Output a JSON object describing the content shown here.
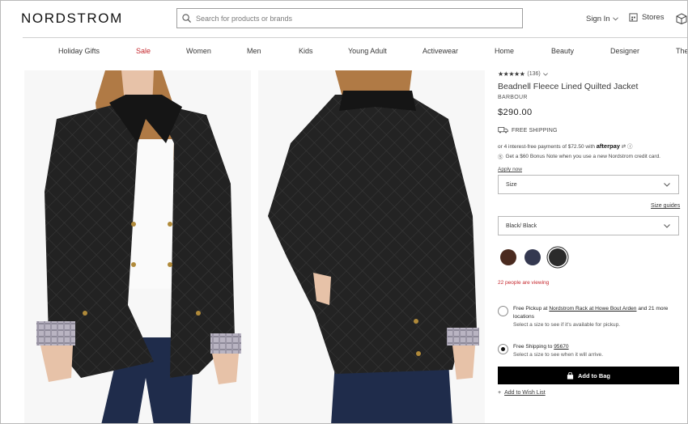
{
  "header": {
    "logo": "NORDSTROM",
    "search_placeholder": "Search for products or brands",
    "signin_label": "Sign In",
    "stores_label": "Stores"
  },
  "nav": {
    "items": [
      "Holiday Gifts",
      "Sale",
      "Women",
      "Men",
      "Kids",
      "Young Adult",
      "Activewear",
      "Home",
      "Beauty",
      "Designer",
      "The"
    ]
  },
  "product": {
    "stars": "★★★★★",
    "review_count": "(136)",
    "rating_value": 4.5,
    "name": "Beadnell Fleece Lined Quilted Jacket",
    "brand": "BARBOUR",
    "price": "$290.00",
    "shipping_label": "FREE SHIPPING",
    "afterpay_text": "or 4 interest-free payments of $72.50 with",
    "afterpay_brand": "afterpay",
    "bonus_text": "Get a $60 Bonus Note when you use a new Nordstrom credit card.",
    "apply_now": "Apply now",
    "size_label": "Size",
    "size_guides": "Size guides",
    "color_label": "Black/ Black",
    "swatches": [
      "#4a2a1f",
      "#343850",
      "#2b2b2b"
    ],
    "viewing_text": "22 people are viewing"
  },
  "fulfillment": {
    "pickup_prefix": "Free Pickup at",
    "pickup_store": "Nordstrom Rack at Howe Bout Arden",
    "pickup_suffix": "and 21 more locations",
    "pickup_sub": "Select a size to see if it's available for pickup.",
    "shipping_prefix": "Free Shipping to",
    "shipping_zip": "95670",
    "shipping_sub": "Select a size to see when it will arrive."
  },
  "actions": {
    "add_to_bag": "Add to Bag",
    "wish_list": "Add to Wish List"
  },
  "colors": {
    "sale": "#c5262c",
    "button": "#000000"
  }
}
